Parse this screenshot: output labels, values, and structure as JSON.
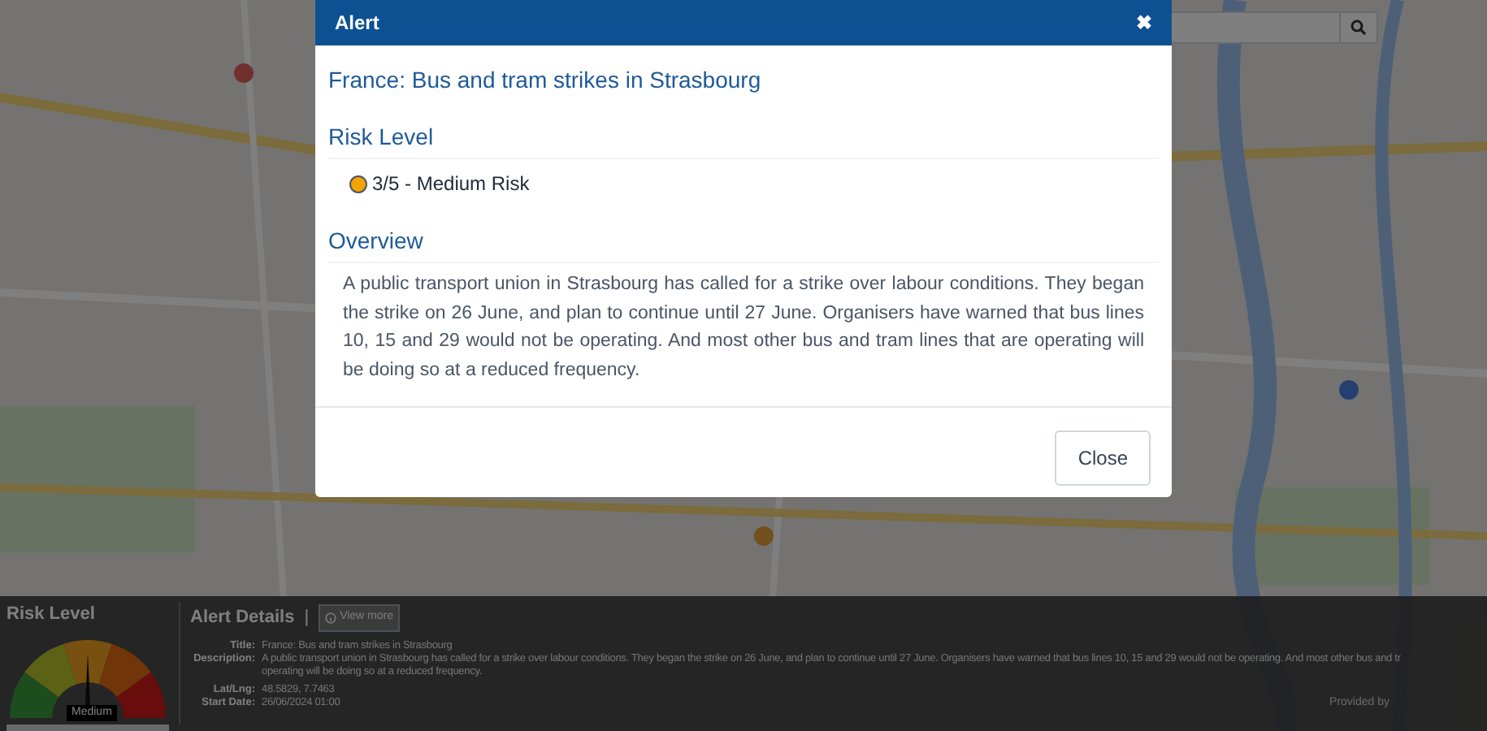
{
  "modal": {
    "title": "Alert",
    "close_icon": "✖",
    "headline": "France: Bus and tram strikes in Strasbourg",
    "risk_heading": "Risk Level",
    "risk": {
      "label": "3/5 - Medium Risk",
      "color": "#f5a300"
    },
    "overview_heading": "Overview",
    "overview": "A public transport union in Strasbourg has called for a strike over labour conditions. They began the strike on 26 June, and plan to continue until 27 June. Organisers have warned that bus lines 10, 15 and 29 would not be operating. And most other bus and tram lines that are operating will be doing so at a reduced frequency.",
    "close_button": "Close"
  },
  "panel": {
    "risk_title": "Risk Level",
    "gauge": {
      "label": "Medium"
    },
    "details_title": "Alert Details",
    "separator": "|",
    "view_more": "View more",
    "fields": [
      {
        "label": "Title:",
        "lines": [
          "France: Bus and tram strikes in Strasbourg"
        ]
      },
      {
        "label": "Description:",
        "lines": [
          "A public transport union in Strasbourg has called for a strike over labour conditions. They began the strike on 26 June, and plan to continue until 27 June. Organisers have warned that bus lines 10, 15 and 29 would not be operating. And most other bus and tr",
          "operating will be doing so at a reduced frequency."
        ]
      },
      {
        "label": "Lat/Lng:",
        "lines": [
          "48.5829, 7.7463"
        ]
      },
      {
        "label": "Start Date:",
        "lines": [
          "26/06/2024 01:00"
        ]
      }
    ],
    "provided_by": "Provided by"
  }
}
